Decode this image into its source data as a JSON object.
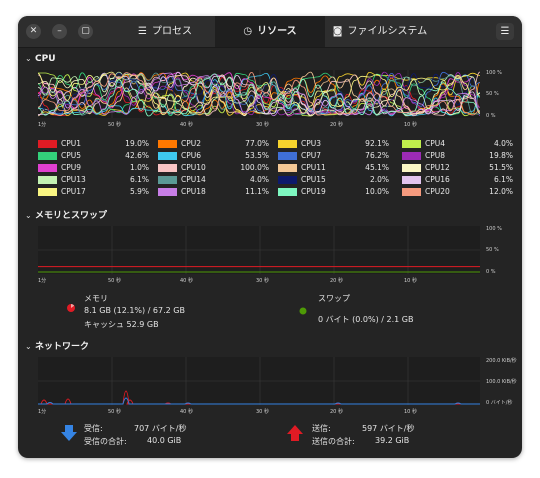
{
  "window": {
    "tabs": [
      {
        "label": "プロセス",
        "icon": "list-icon"
      },
      {
        "label": "リソース",
        "icon": "clock-icon"
      },
      {
        "label": "ファイルシステム",
        "icon": "disk-icon"
      }
    ],
    "active_tab": 1
  },
  "cpu": {
    "title": "CPU",
    "y_ticks": [
      "100 %",
      "50 %",
      "0 %"
    ],
    "x_ticks": [
      "1分",
      "50 秒",
      "40 秒",
      "30 秒",
      "20 秒",
      "10 秒"
    ],
    "cores": [
      {
        "name": "CPU1",
        "value": "19.0%",
        "color": "#e01b24"
      },
      {
        "name": "CPU2",
        "value": "77.0%",
        "color": "#ff7800"
      },
      {
        "name": "CPU3",
        "value": "92.1%",
        "color": "#f6d32d"
      },
      {
        "name": "CPU4",
        "value": "4.0%",
        "color": "#c0ef4c"
      },
      {
        "name": "CPU5",
        "value": "42.6%",
        "color": "#33d17a"
      },
      {
        "name": "CPU6",
        "value": "53.5%",
        "color": "#3ec9f0"
      },
      {
        "name": "CPU7",
        "value": "76.2%",
        "color": "#3f6fd6"
      },
      {
        "name": "CPU8",
        "value": "19.8%",
        "color": "#9d2bb5"
      },
      {
        "name": "CPU9",
        "value": "1.0%",
        "color": "#e03fd0"
      },
      {
        "name": "CPU10",
        "value": "100.0%",
        "color": "#f8c4c4"
      },
      {
        "name": "CPU11",
        "value": "45.1%",
        "color": "#f4c896"
      },
      {
        "name": "CPU12",
        "value": "51.5%",
        "color": "#fbf7c5"
      },
      {
        "name": "CPU13",
        "value": "6.1%",
        "color": "#c3f2b3"
      },
      {
        "name": "CPU14",
        "value": "4.0%",
        "color": "#5a9a96"
      },
      {
        "name": "CPU15",
        "value": "2.0%",
        "color": "#0d1a6b"
      },
      {
        "name": "CPU16",
        "value": "6.1%",
        "color": "#e2c4ee"
      },
      {
        "name": "CPU17",
        "value": "5.9%",
        "color": "#f9f582"
      },
      {
        "name": "CPU18",
        "value": "11.1%",
        "color": "#c77ee6"
      },
      {
        "name": "CPU19",
        "value": "10.0%",
        "color": "#7ef7c0"
      },
      {
        "name": "CPU20",
        "value": "12.0%",
        "color": "#f59a7e"
      }
    ]
  },
  "memory": {
    "title": "メモリとスワップ",
    "y_ticks": [
      "100 %",
      "50 %",
      "0 %"
    ],
    "x_ticks": [
      "1分",
      "50 秒",
      "40 秒",
      "30 秒",
      "20 秒",
      "10 秒"
    ],
    "mem_label": "メモリ",
    "mem_value": "8.1 GB (12.1%) / 67.2 GB",
    "cache_value": "キャッシュ 52.9 GB",
    "mem_percent": 12.1,
    "swap_label": "スワップ",
    "swap_value": "0 バイト (0.0%) / 2.1 GB",
    "swap_percent": 0.0,
    "mem_color": "#e01b24",
    "swap_color": "#4e9a06"
  },
  "network": {
    "title": "ネットワーク",
    "y_ticks": [
      "200.0 KiB/秒",
      "100.0 KiB/秒",
      "0 バイト/秒"
    ],
    "x_ticks": [
      "1分",
      "50 秒",
      "40 秒",
      "30 秒",
      "20 秒",
      "10 秒"
    ],
    "recv_label": "受信:",
    "recv_value": "707 バイト/秒",
    "recv_total_label": "受信の合計:",
    "recv_total_value": "40.0 GiB",
    "send_label": "送信:",
    "send_value": "597 バイト/秒",
    "send_total_label": "送信の合計:",
    "send_total_value": "39.2 GiB",
    "recv_color": "#3584e4",
    "send_color": "#e01b24"
  }
}
